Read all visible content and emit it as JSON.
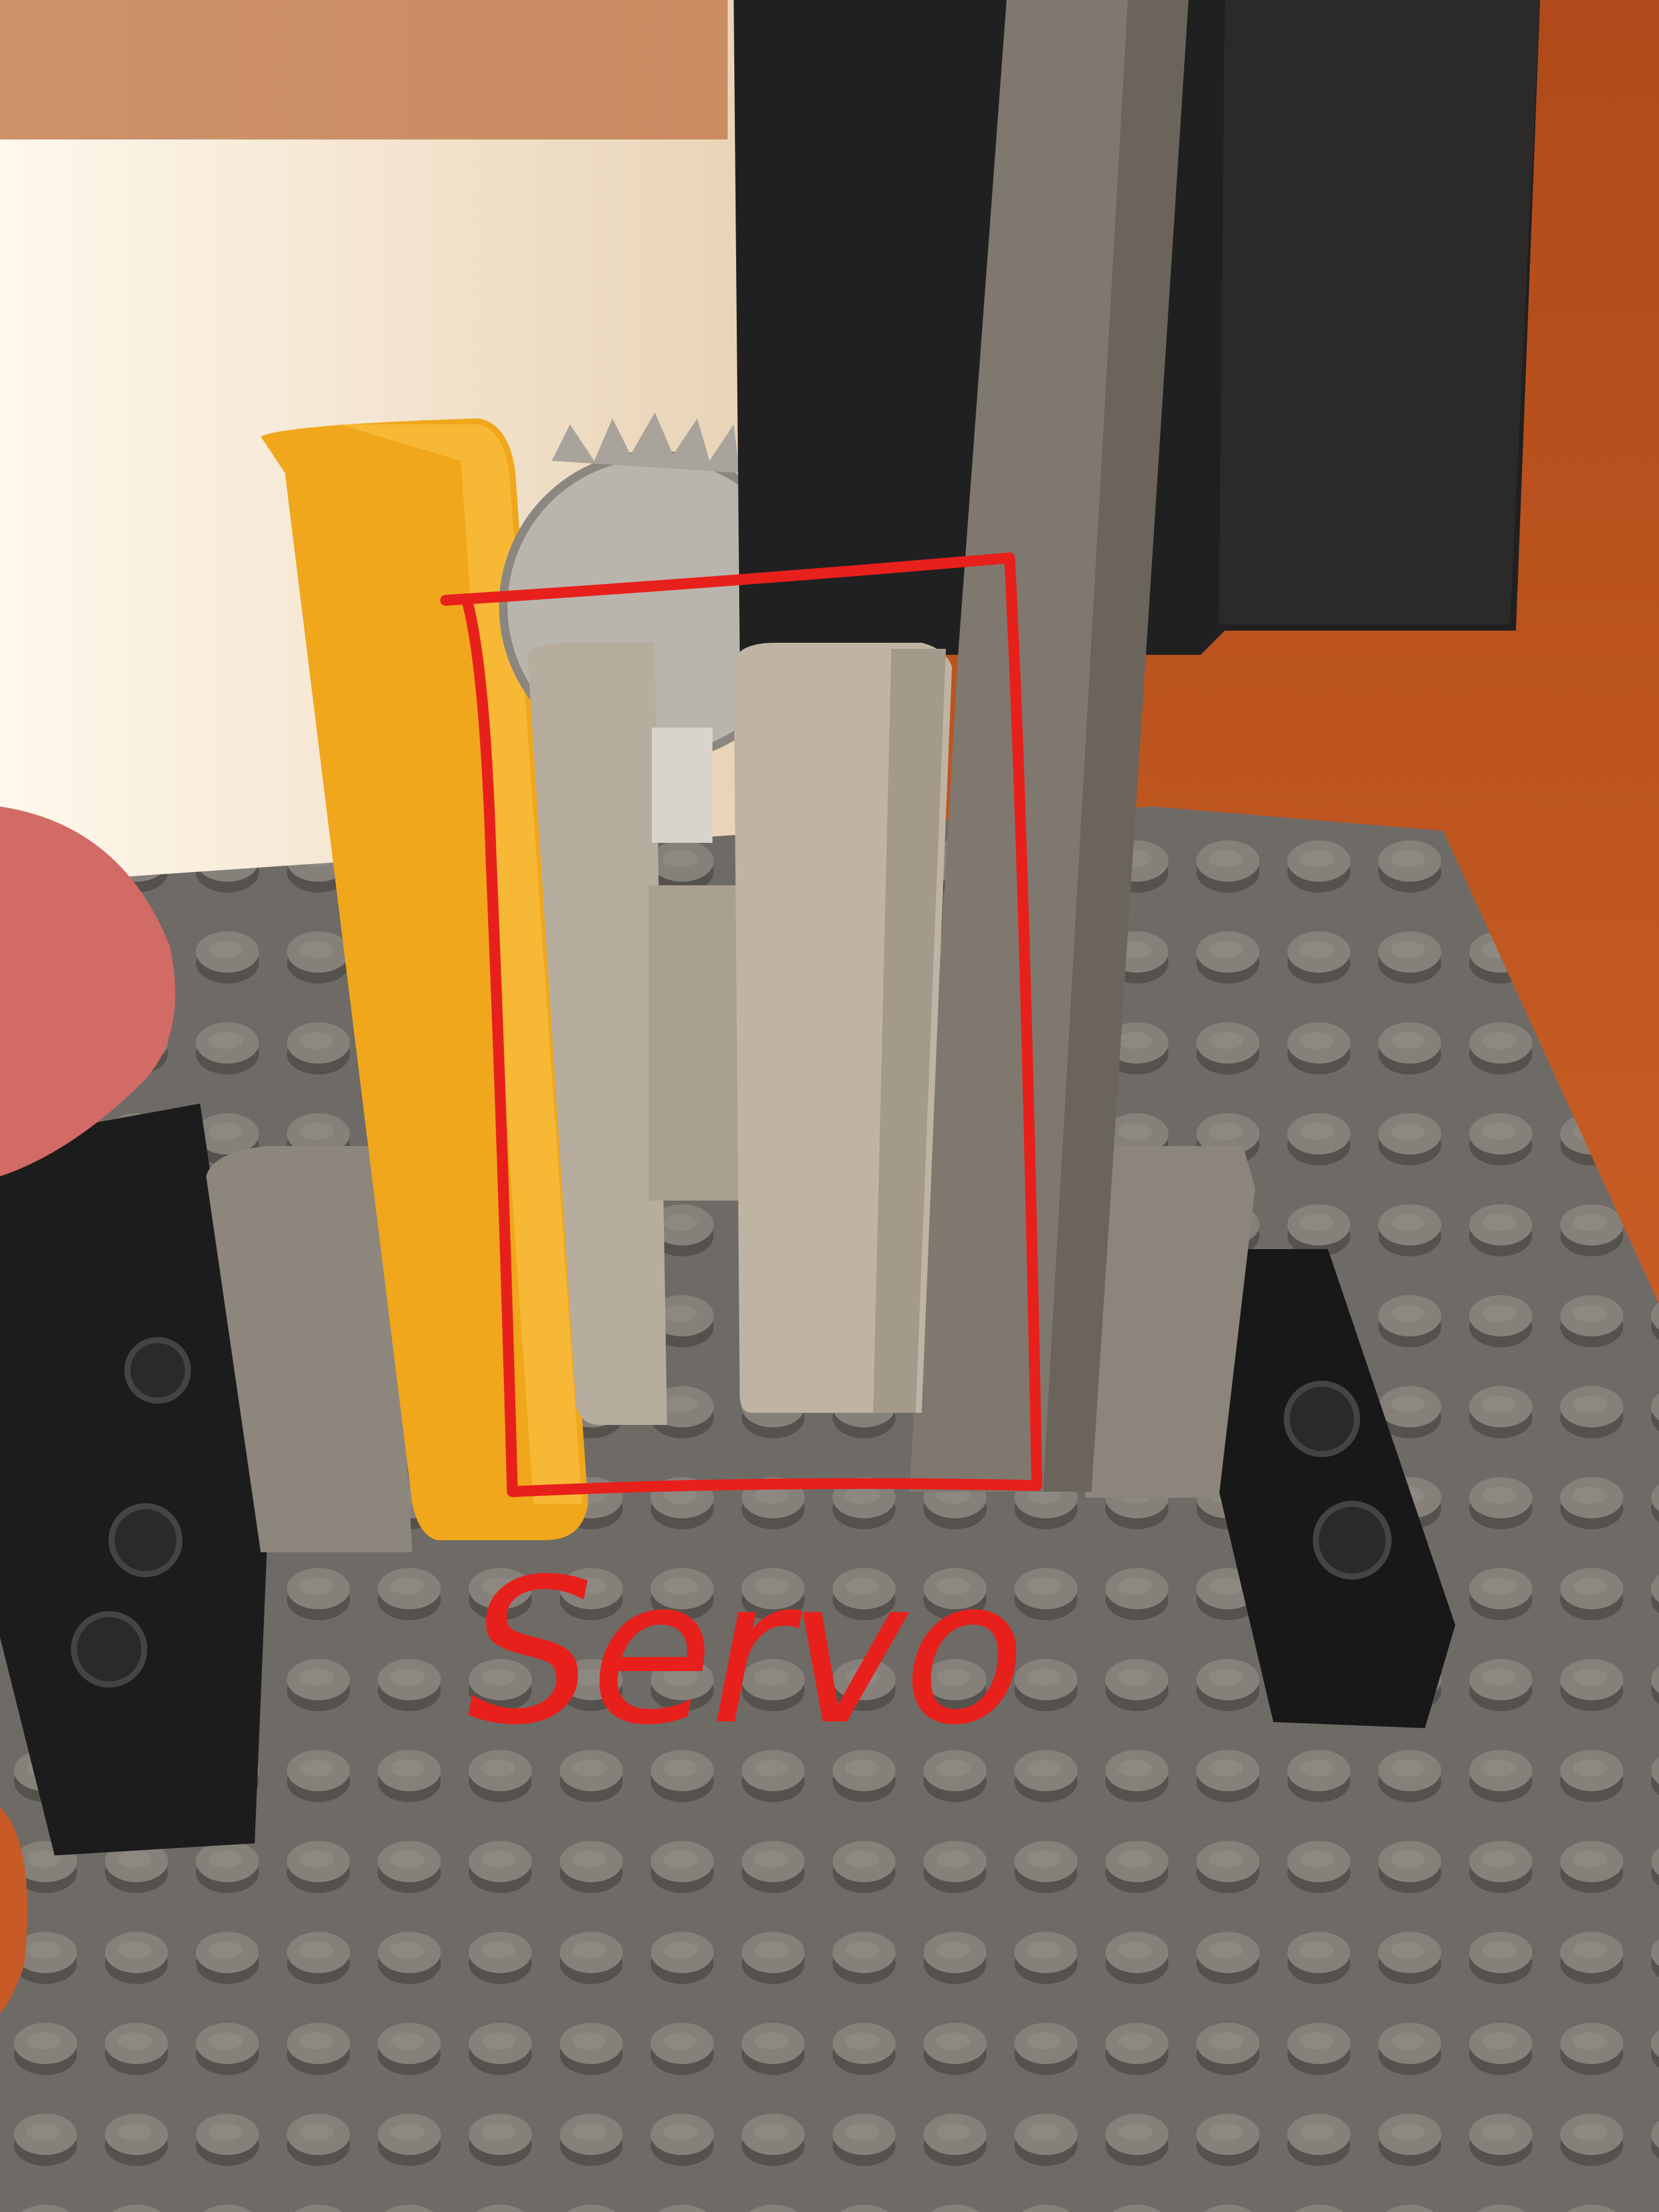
{
  "annotation": {
    "label": "Servo",
    "color": "#e8201c"
  },
  "colors": {
    "carpet": "#c65a22",
    "baseplate": "#6e6b66",
    "stud": "#7d7a74",
    "yellow_brick": "#f0a71c",
    "light_gray": "#b4aa9c",
    "dark_bluish_gray": "#7a746c",
    "black": "#1a1a1a"
  }
}
